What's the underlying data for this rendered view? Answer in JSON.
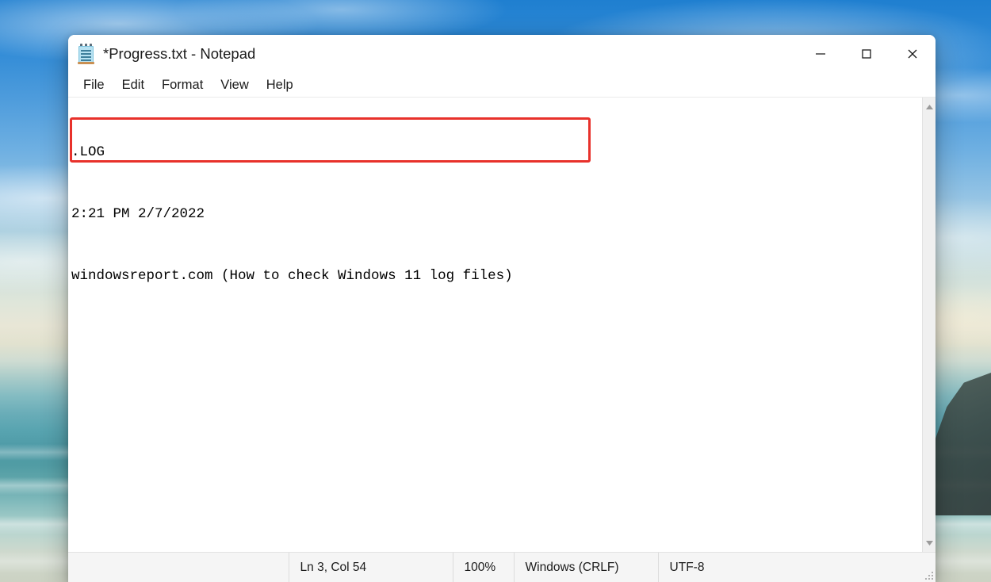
{
  "window": {
    "title": "*Progress.txt - Notepad",
    "icon": "notepad-icon",
    "controls": {
      "minimize_label": "Minimize",
      "maximize_label": "Maximize",
      "close_label": "Close"
    }
  },
  "menu": {
    "items": [
      {
        "label": "File"
      },
      {
        "label": "Edit"
      },
      {
        "label": "Format"
      },
      {
        "label": "View"
      },
      {
        "label": "Help"
      }
    ]
  },
  "editor": {
    "lines": [
      ".LOG",
      "2:21 PM 2/7/2022",
      "windowsreport.com (How to check Windows 11 log files)"
    ],
    "highlight": {
      "color": "#e8312b",
      "covers_lines": "2-3"
    }
  },
  "scrollbar": {
    "up_arrow": "scroll-up-arrow-icon",
    "down_arrow": "scroll-down-arrow-icon"
  },
  "status_bar": {
    "cursor_position": "Ln 3, Col 54",
    "zoom": "100%",
    "line_ending": "Windows (CRLF)",
    "encoding": "UTF-8"
  }
}
